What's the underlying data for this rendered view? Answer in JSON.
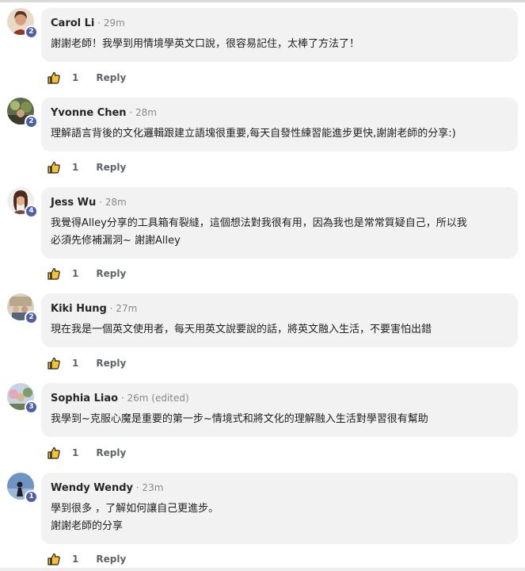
{
  "comments": [
    {
      "author": "Carol Li",
      "time": " · 29m",
      "badge": "2",
      "likes": "1",
      "reply_label": "Reply",
      "lines": [
        "謝謝老師！我學到用情境學英文口說，很容易記住，太棒了方法了！"
      ]
    },
    {
      "author": "Yvonne Chen",
      "time": " · 28m",
      "badge": "2",
      "likes": "1",
      "reply_label": "Reply",
      "lines": [
        "理解語言背後的文化邏輯跟建立語塊很重要,每天自發性練習能進步更快,謝謝老師的分享:)"
      ]
    },
    {
      "author": "Jess Wu",
      "time": " · 28m",
      "badge": "4",
      "likes": "1",
      "reply_label": "Reply",
      "lines": [
        "我覺得Alley分享的工具箱有裂縫，這個想法對我很有用，因為我也是常常質疑自己，所以我",
        "必須先修補漏洞~ 謝謝Alley"
      ]
    },
    {
      "author": "Kiki Hung",
      "time": " · 27m",
      "badge": "2",
      "likes": "1",
      "reply_label": "Reply",
      "lines": [
        "現在我是一個英文使用者，每天用英文說要說的話，將英文融入生活，不要害怕出錯"
      ]
    },
    {
      "author": "Sophia Liao",
      "time": " · 26m (edited)",
      "badge": "3",
      "likes": "1",
      "reply_label": "Reply",
      "lines": [
        "我學到~克服心魔是重要的第一步~情境式和將文化的理解融入生活對學習很有幫助"
      ]
    },
    {
      "author": "Wendy Wendy",
      "time": " · 23m",
      "badge": "1",
      "likes": "1",
      "reply_label": "Reply",
      "lines": [
        "學到很多 ，了解如何讓自己更進步。",
        "謝謝老師的分享"
      ]
    }
  ],
  "colors": {
    "bubble": "#f2f2f2",
    "badge": "#4e5fa6",
    "like": "#f5c233"
  },
  "icons": {
    "like": "thumbs-up-icon"
  }
}
